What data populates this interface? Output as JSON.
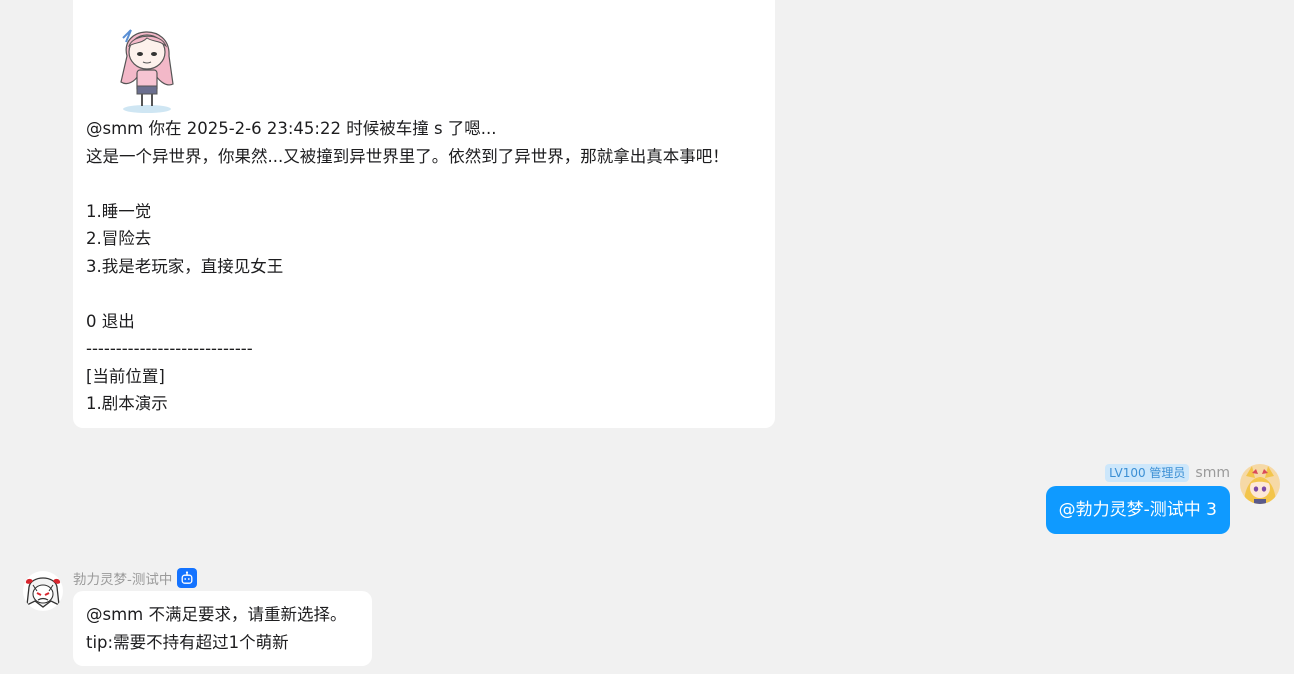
{
  "messages": {
    "bot_story": {
      "sticker": "anime-girl-sticker",
      "lines": [
        "@smm 你在 2025-2-6 23:45:22 时候被车撞 s 了嗯...",
        "这是一个异世界，你果然...又被撞到异世界里了。依然到了异世界，那就拿出真本事吧！",
        "",
        "1.睡一觉",
        "2.冒险去",
        "3.我是老玩家，直接见女王",
        "",
        "0 退出",
        "----------------------------",
        "[当前位置]",
        "1.剧本演示"
      ]
    },
    "user_message": {
      "badge": "LV100 管理员",
      "name": "smm",
      "text": "@勃力灵梦-测试中 3",
      "avatar": "user-avatar-icon"
    },
    "bot_reply": {
      "name": "勃力灵梦-测试中",
      "badge_icon": "bot-robot-icon",
      "lines": [
        "@smm 不满足要求，请重新选择。",
        "tip:需要不持有超过1个萌新"
      ],
      "avatar": "bot-avatar-icon"
    }
  },
  "colors": {
    "background": "#f1f1f1",
    "bubble_left": "#ffffff",
    "bubble_right": "#0f9aff",
    "badge_bg": "#cde7fb",
    "bot_badge": "#1473ff"
  }
}
